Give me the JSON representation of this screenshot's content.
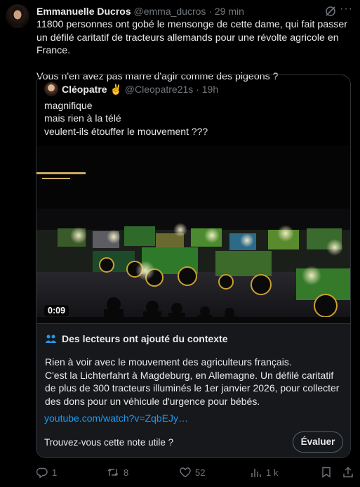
{
  "author": {
    "name": "Emmanuelle Ducros",
    "handle": "@emma_ducros",
    "separator": "·",
    "time": "29 min"
  },
  "tweet": {
    "paragraphs": [
      "11800 personnes ont gobé le mensonge de cette dame, qui fait passer un défilé caritatif de tracteurs allemands pour une révolte agricole en France.",
      "Vous n'en avez pas marre d'agir comme des pigeons ?"
    ]
  },
  "quote": {
    "name": "Cléopatre",
    "emoji": "✌️",
    "handle": "@Cleopatre21s",
    "separator": "·",
    "time": "19h",
    "lines": [
      "magnifique",
      "mais rien à la télé",
      "veulent-ils étouffer le mouvement ???"
    ],
    "video_duration": "0:09"
  },
  "community_note": {
    "title": "Des lecteurs ont ajouté du contexte",
    "body_lines": [
      "Rien à voir avec le mouvement des agriculteurs français.",
      "C'est la Lichterfahrt à Magdeburg, en Allemagne. Un défilé caritatif de plus de 300 tracteurs illuminés le 1er janvier 2026, pour collecter des dons pour un véhicule d'urgence pour bébés."
    ],
    "link": "youtube.com/watch?v=ZqbEJy…",
    "question": "Trouvez-vous cette note utile ?",
    "button": "Évaluer"
  },
  "actions": {
    "replies": "1",
    "reposts": "8",
    "likes": "52",
    "views": "1 k"
  },
  "icons": [
    "grok-icon",
    "more-icon",
    "community-note-icon",
    "reply-icon",
    "repost-icon",
    "like-icon",
    "views-icon",
    "bookmark-icon",
    "share-icon"
  ],
  "colors": {
    "background": "#000000",
    "link": "#1d9bf0",
    "muted": "#71767b",
    "note_bg": "#16181c"
  }
}
